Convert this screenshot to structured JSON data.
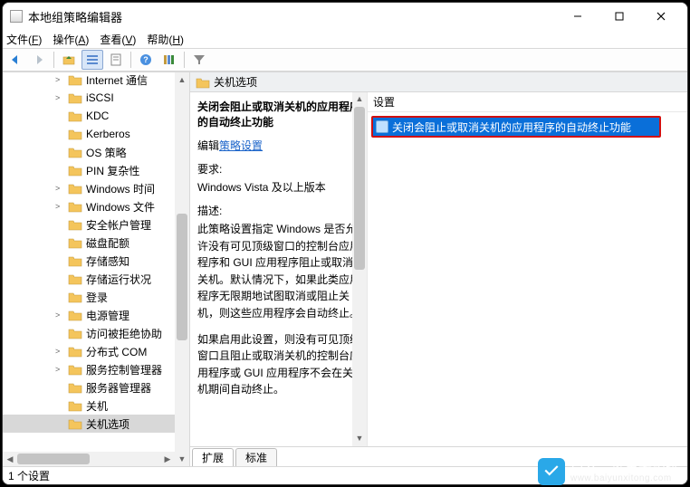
{
  "window": {
    "title": "本地组策略编辑器"
  },
  "menu": {
    "file": "文件(F)",
    "action": "操作(A)",
    "view": "查看(V)",
    "help": "帮助(H)"
  },
  "tree": {
    "items": [
      {
        "label": "Internet 通信",
        "exp": ">",
        "level": 1
      },
      {
        "label": "iSCSI",
        "exp": ">",
        "level": 1
      },
      {
        "label": "KDC",
        "exp": "",
        "level": 1
      },
      {
        "label": "Kerberos",
        "exp": "",
        "level": 1
      },
      {
        "label": "OS 策略",
        "exp": "",
        "level": 1
      },
      {
        "label": "PIN 复杂性",
        "exp": "",
        "level": 1
      },
      {
        "label": "Windows 时间",
        "exp": ">",
        "level": 1
      },
      {
        "label": "Windows 文件",
        "exp": ">",
        "level": 1
      },
      {
        "label": "安全帐户管理",
        "exp": "",
        "level": 1
      },
      {
        "label": "磁盘配额",
        "exp": "",
        "level": 1
      },
      {
        "label": "存储感知",
        "exp": "",
        "level": 1
      },
      {
        "label": "存储运行状况",
        "exp": "",
        "level": 1
      },
      {
        "label": "登录",
        "exp": "",
        "level": 1
      },
      {
        "label": "电源管理",
        "exp": ">",
        "level": 1
      },
      {
        "label": "访问被拒绝协助",
        "exp": "",
        "level": 1
      },
      {
        "label": "分布式 COM",
        "exp": ">",
        "level": 1
      },
      {
        "label": "服务控制管理器",
        "exp": ">",
        "level": 1
      },
      {
        "label": "服务器管理器",
        "exp": "",
        "level": 1
      },
      {
        "label": "关机",
        "exp": "",
        "level": 1
      },
      {
        "label": "关机选项",
        "exp": "",
        "level": 1,
        "selected": true
      }
    ]
  },
  "content": {
    "header": "关机选项",
    "setting_title": "关闭会阻止或取消关机的应用程序的自动终止功能",
    "edit_prefix": "编辑",
    "edit_link": "策略设置",
    "req_hdr": "要求:",
    "req_body": "Windows Vista 及以上版本",
    "desc_hdr": "描述:",
    "desc_p1": "此策略设置指定 Windows 是否允许没有可见顶级窗口的控制台应用程序和 GUI 应用程序阻止或取消关机。默认情况下，如果此类应用程序无限期地试图取消或阻止关机，则这些应用程序会自动终止。",
    "desc_p2": "如果启用此设置，则没有可见顶级窗口且阻止或取消关机的控制台应用程序或 GUI 应用程序不会在关机期间自动终止。",
    "list": {
      "col_setting": "设置",
      "row1": "关闭会阻止或取消关机的应用程序的自动终止功能"
    },
    "tabs": {
      "extended": "扩展",
      "standard": "标准"
    }
  },
  "status": {
    "count": "1 个设置"
  },
  "watermark": {
    "line1": "白云一键重装系统",
    "line2": "www.baiyunxitong.com"
  }
}
